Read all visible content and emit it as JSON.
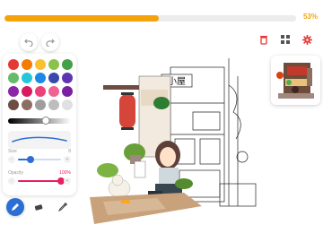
{
  "progress": {
    "percent_label": "53%",
    "value": 0.53
  },
  "toolbar": {
    "undo_icon": "undo-icon",
    "redo_icon": "redo-icon",
    "delete_icon": "trash-icon",
    "gallery_icon": "grid-icon",
    "settings_icon": "gear-icon"
  },
  "palette": {
    "colors": [
      "#e53935",
      "#f57c00",
      "#fbc02d",
      "#8bc34a",
      "#43a047",
      "#66bb6a",
      "#26c6da",
      "#1e88e5",
      "#3949ab",
      "#5e35b1",
      "#8e24aa",
      "#d81b60",
      "#ec407a",
      "#f06292",
      "#7b1fa2",
      "#6d4c41",
      "#8d6e63",
      "#9e9e9e",
      "#bdbdbd",
      "#e0e0e0"
    ],
    "brightness": 0.6
  },
  "size": {
    "label": "Size",
    "value": "8",
    "minus": "-",
    "plus": "+",
    "level": 0.3
  },
  "opacity": {
    "label": "Opacity",
    "value": "100%",
    "minus": "-",
    "plus": "+",
    "level": 1.0
  },
  "canvas": {
    "sign_text": "小屋"
  },
  "brushes": {
    "pen_icon": "pen-icon",
    "eraser_icon": "eraser-icon",
    "picker_icon": "eyedropper-icon"
  },
  "colors": {
    "accent": "#f5a30b",
    "active_tool": "#2b6fd6",
    "danger": "#e53935",
    "opacity_track": "#e91e63",
    "size_track": "#2b6fd6"
  }
}
